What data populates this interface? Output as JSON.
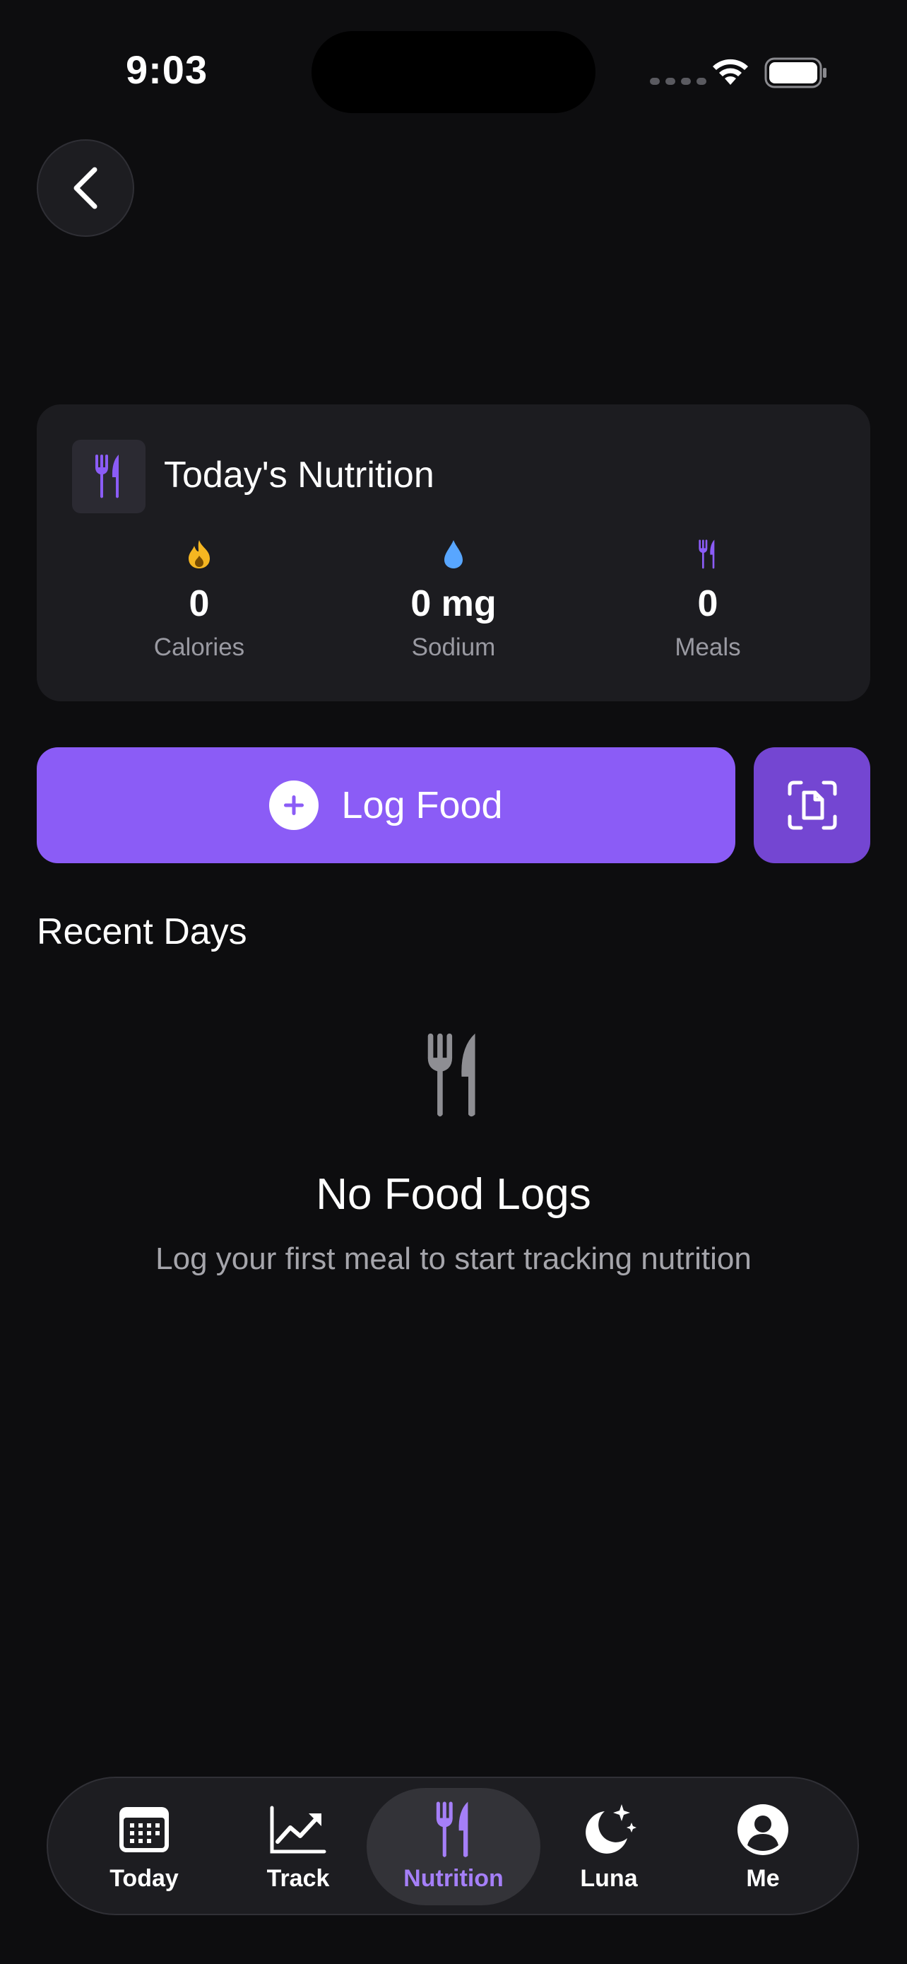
{
  "status_bar": {
    "time": "9:03"
  },
  "card": {
    "title": "Today's Nutrition",
    "stats": [
      {
        "value": "0",
        "label": "Calories",
        "icon": "flame-icon",
        "color": "#f5b621"
      },
      {
        "value": "0 mg",
        "label": "Sodium",
        "icon": "drop-icon",
        "color": "#58a6ff"
      },
      {
        "value": "0",
        "label": "Meals",
        "icon": "fork-knife-icon",
        "color": "#8b5cf6"
      }
    ]
  },
  "actions": {
    "log_food_label": "Log Food",
    "scan_icon": "document-scan-icon"
  },
  "recent": {
    "title": "Recent Days",
    "empty_title": "No Food Logs",
    "empty_subtitle": "Log your first meal to start tracking nutrition"
  },
  "tabs": [
    {
      "label": "Today",
      "icon": "calendar-icon"
    },
    {
      "label": "Track",
      "icon": "chart-trend-icon"
    },
    {
      "label": "Nutrition",
      "icon": "fork-knife-icon",
      "active": true
    },
    {
      "label": "Luna",
      "icon": "moon-stars-icon"
    },
    {
      "label": "Me",
      "icon": "person-circle-icon"
    }
  ],
  "colors": {
    "accent": "#8b5cf6",
    "accent_dark": "#7446d2",
    "background": "#0d0d0f",
    "card": "#1c1c20"
  }
}
